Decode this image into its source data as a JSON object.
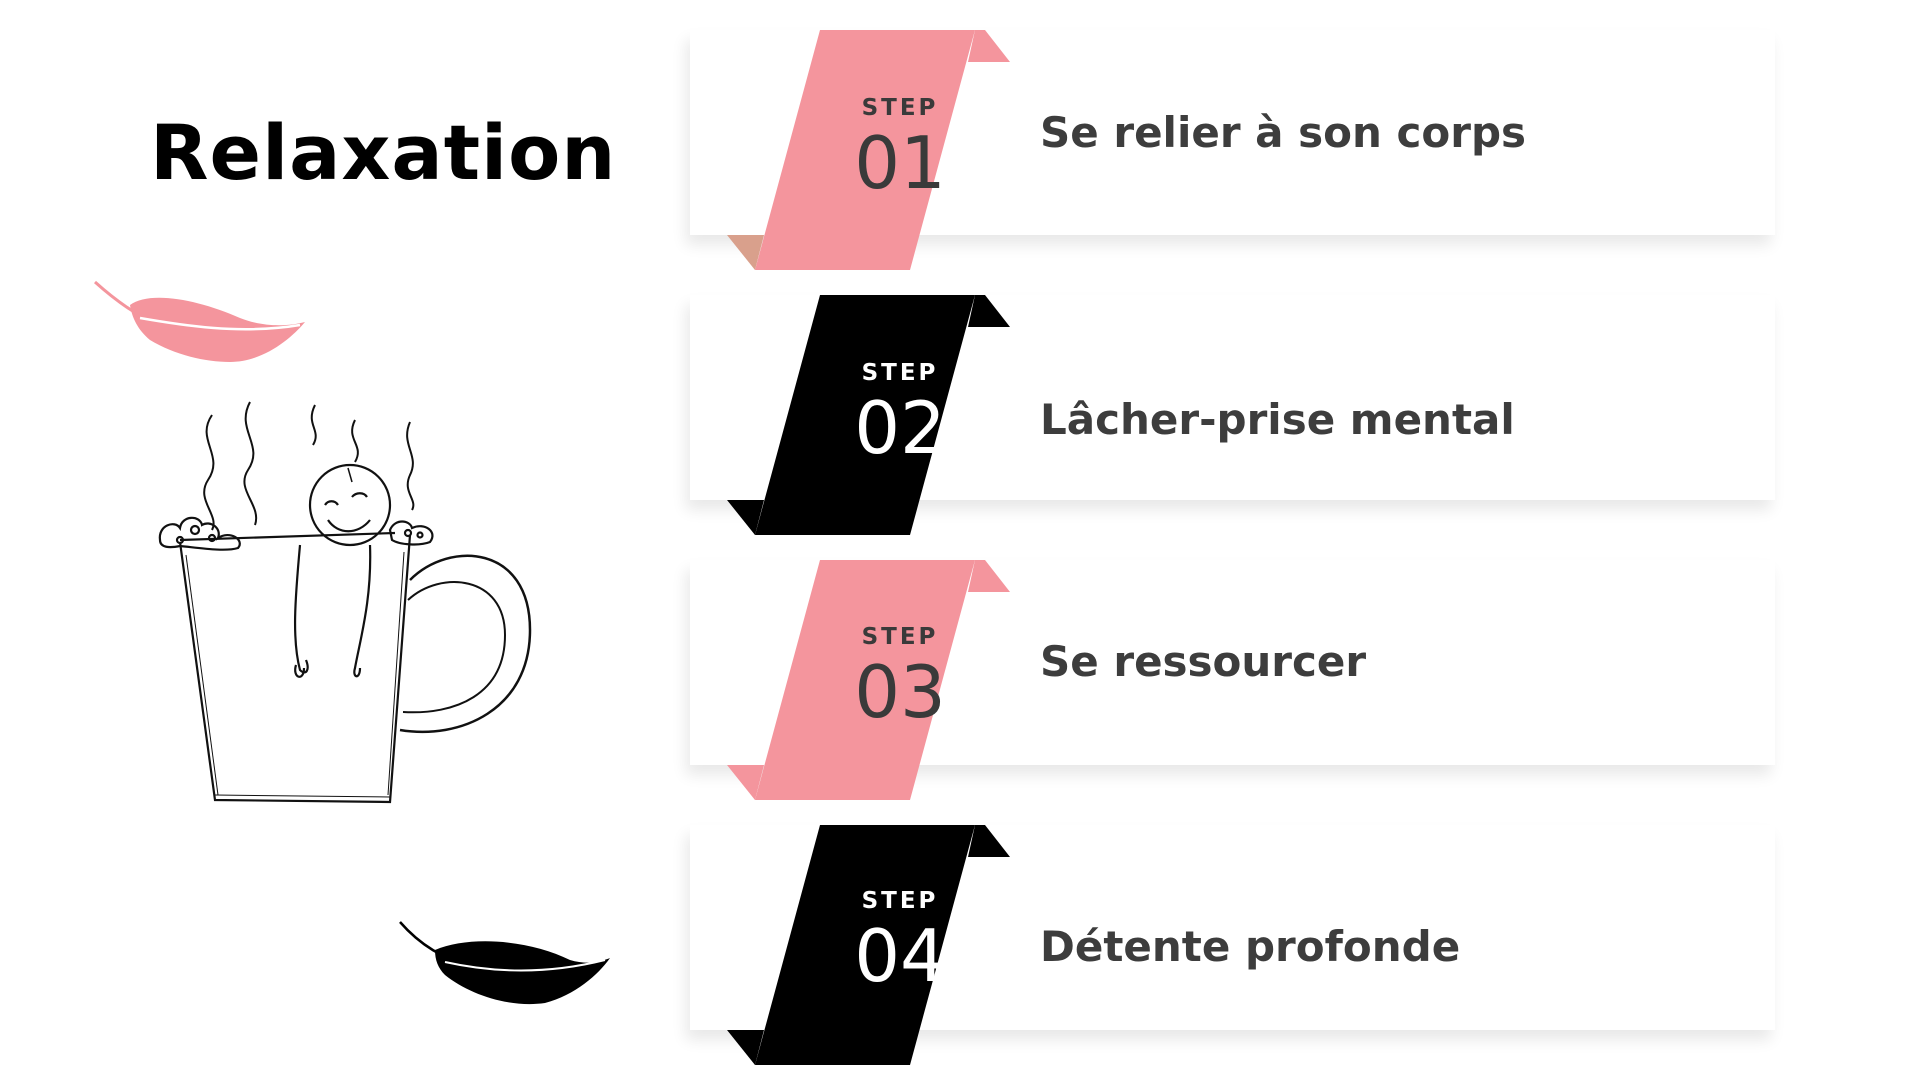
{
  "title": "Relaxation",
  "colors": {
    "pink": "#f4959d",
    "pink_fold": "#d9a08c",
    "black": "#000000",
    "text": "#3d3d3d"
  },
  "illustration": {
    "top_feather": "pink-feather-icon",
    "mug": "stick-figure-in-mug-icon",
    "bottom_feather": "black-feather-icon"
  },
  "steps": [
    {
      "label": "STEP",
      "number": "01",
      "text": "Se relier à son corps",
      "color": "pink"
    },
    {
      "label": "STEP",
      "number": "02",
      "text": "Lâcher-prise mental",
      "color": "black"
    },
    {
      "label": "STEP",
      "number": "03",
      "text": "Se ressourcer",
      "color": "pink"
    },
    {
      "label": "STEP",
      "number": "04",
      "text": "Détente profonde",
      "color": "black"
    }
  ]
}
